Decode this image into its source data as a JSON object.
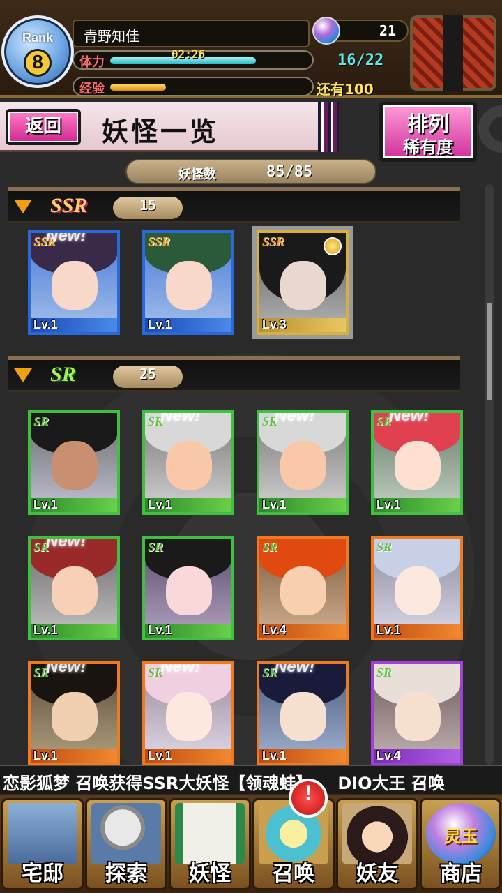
{
  "player": {
    "rank_label": "Rank",
    "rank": "8",
    "name": "青野知佳",
    "stamina_label": "体力",
    "stamina_timer": "02:26",
    "stamina_value": "16/22",
    "stamina_fraction": 0.73,
    "exp_label": "经验",
    "exp_fraction": 0.28,
    "exp_remaining": "还有100",
    "orb_count": "21"
  },
  "header": {
    "back_label": "返回",
    "title": "妖怪一览",
    "sort_label": "排列",
    "sort_value": "稀有度"
  },
  "count": {
    "label": "妖怪数",
    "value": "85/85"
  },
  "sections": [
    {
      "rarity": "SSR",
      "count": "15",
      "cards": [
        {
          "level": "Lv.1",
          "new": "New!",
          "badge": "SSR",
          "frame": "blue"
        },
        {
          "level": "Lv.1",
          "new": "",
          "badge": "SSR",
          "frame": "blue"
        },
        {
          "level": "Lv.3",
          "new": "",
          "badge": "SSR",
          "frame": "gold"
        }
      ]
    },
    {
      "rarity": "SR",
      "count": "25",
      "cards": [
        {
          "level": "Lv.1",
          "new": "",
          "badge": "SR",
          "frame": "green"
        },
        {
          "level": "Lv.1",
          "new": "New!",
          "badge": "SR",
          "frame": "green"
        },
        {
          "level": "Lv.1",
          "new": "New!",
          "badge": "SR",
          "frame": "green"
        },
        {
          "level": "Lv.1",
          "new": "New!",
          "badge": "SR",
          "frame": "green"
        },
        {
          "level": "Lv.1",
          "new": "New!",
          "badge": "SR",
          "frame": "green"
        },
        {
          "level": "Lv.1",
          "new": "",
          "badge": "SR",
          "frame": "green"
        },
        {
          "level": "Lv.4",
          "new": "",
          "badge": "SR",
          "frame": "orange"
        },
        {
          "level": "Lv.1",
          "new": "",
          "badge": "SR",
          "frame": "orange"
        },
        {
          "level": "Lv.1",
          "new": "New!",
          "badge": "SR",
          "frame": "orange"
        },
        {
          "level": "Lv.1",
          "new": "New!",
          "badge": "SR",
          "frame": "orange"
        },
        {
          "level": "Lv.1",
          "new": "New!",
          "badge": "SR",
          "frame": "orange"
        },
        {
          "level": "Lv.4",
          "new": "",
          "badge": "SR",
          "frame": "purple"
        }
      ]
    }
  ],
  "ticker": "恋影狐梦 召唤获得SSR大妖怪【领魂蛙】　　DIO大王 召唤",
  "nav": [
    {
      "label": "宅邸",
      "icon": "mansion-icon"
    },
    {
      "label": "探索",
      "icon": "magnifier-icon"
    },
    {
      "label": "妖怪",
      "icon": "scroll-icon"
    },
    {
      "label": "召唤",
      "icon": "pentagram-icon"
    },
    {
      "label": "妖友",
      "icon": "friend-icon"
    },
    {
      "label": "商店",
      "icon": "spirit-orb-icon"
    }
  ],
  "nav_badge": "!",
  "nav_orb_text": "灵玉",
  "colors": {
    "accent_pink": "#d02890",
    "ssr_blue": "#2a6ad8",
    "sr_green": "#40c040",
    "orange_frame": "#f07a20",
    "purple_frame": "#a040d8"
  }
}
